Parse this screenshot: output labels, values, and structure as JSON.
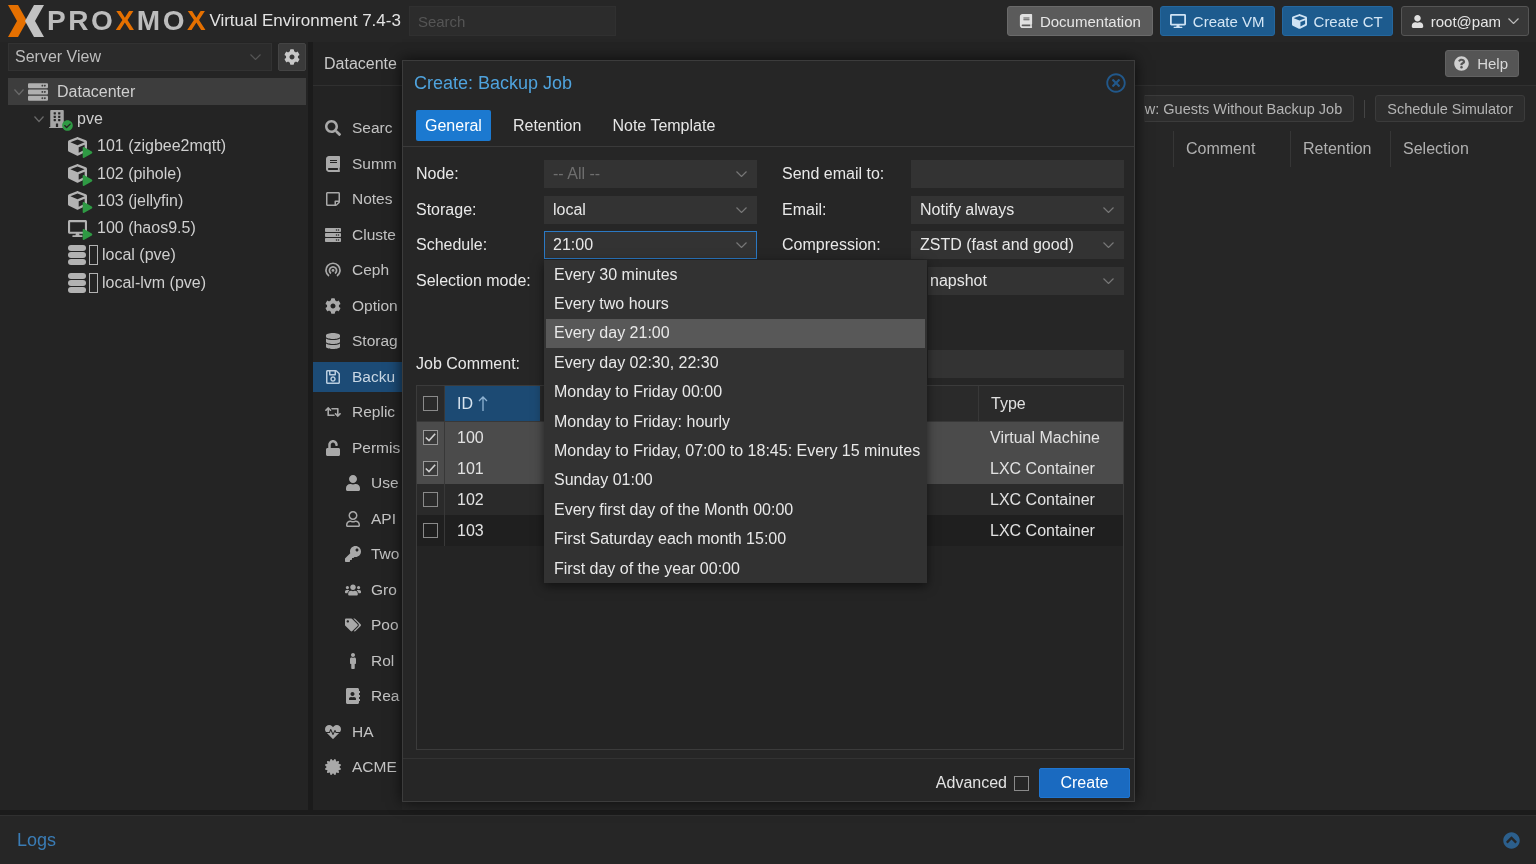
{
  "top_bar": {
    "logo": "PROXMOX",
    "product": "Virtual Environment 7.4-3",
    "search": {
      "placeholder": "Search"
    },
    "buttons": [
      {
        "label": "Documentation",
        "kind": "plain"
      },
      {
        "label": "Create VM",
        "kind": "primary"
      },
      {
        "label": "Create CT",
        "kind": "primary"
      },
      {
        "label": "root@pam",
        "kind": "menu"
      }
    ]
  },
  "sidebar": {
    "view_select": {
      "value": "Server View"
    },
    "tree": [
      {
        "label": "Datacenter",
        "kind": "datacenter",
        "selected": true,
        "expanded": true,
        "children": [
          {
            "label": "pve",
            "kind": "node",
            "selected": false,
            "expanded": true,
            "online": true,
            "children": [
              {
                "label": "101 (zigbee2mqtt)",
                "kind": "container",
                "selected": false,
                "running": true
              },
              {
                "label": "102 (pihole)",
                "kind": "container",
                "selected": false,
                "running": true
              },
              {
                "label": "103 (jellyfin)",
                "kind": "container",
                "selected": false,
                "running": true
              },
              {
                "label": "100 (haos9.5)",
                "kind": "vm",
                "selected": false,
                "running": true
              },
              {
                "label": "local (pve)",
                "kind": "storage",
                "selected": false,
                "running": false
              },
              {
                "label": "local-lvm (pve)",
                "kind": "storage",
                "selected": false,
                "running": false
              }
            ]
          }
        ]
      }
    ]
  },
  "main": {
    "breadcrumb": "Datacente",
    "help_button": "Help",
    "nav": [
      {
        "label": "Searc",
        "selected": false
      },
      {
        "label": "Summ",
        "selected": false
      },
      {
        "label": "Notes",
        "selected": false
      },
      {
        "label": "Cluste",
        "selected": false
      },
      {
        "label": "Ceph",
        "selected": false
      },
      {
        "label": "Option",
        "selected": false
      },
      {
        "label": "Storag",
        "selected": false
      },
      {
        "label": "Backu",
        "selected": true
      },
      {
        "label": "Replic",
        "selected": false
      },
      {
        "label": "Permis",
        "selected": false,
        "children": [
          {
            "label": "Use",
            "selected": false
          },
          {
            "label": "API",
            "selected": false
          },
          {
            "label": "Two",
            "selected": false
          },
          {
            "label": "Gro",
            "selected": false
          },
          {
            "label": "Poo",
            "selected": false
          },
          {
            "label": "Rol",
            "selected": false
          },
          {
            "label": "Rea",
            "selected": false
          }
        ]
      },
      {
        "label": "HA",
        "selected": false
      },
      {
        "label": "ACME",
        "selected": false
      }
    ],
    "toolbar": [
      "w: Guests Without Backup Job",
      "Schedule Simulator"
    ],
    "columns": [
      "Comment",
      "Retention",
      "Selection"
    ]
  },
  "dialog": {
    "title": "Create: Backup Job",
    "tabs": [
      {
        "label": "General",
        "selected": true
      },
      {
        "label": "Retention",
        "selected": false
      },
      {
        "label": "Note Template",
        "selected": false
      }
    ],
    "form_left": [
      {
        "label": "Node:",
        "kind": "combo",
        "placeholder": "-- All --",
        "focused": false
      },
      {
        "label": "Storage:",
        "kind": "combo",
        "value": "local",
        "focused": false
      },
      {
        "label": "Schedule:",
        "kind": "combo",
        "value": "21:00",
        "focused": true
      },
      {
        "label": "Selection mode:"
      }
    ],
    "form_right": [
      {
        "label": "Send email to:",
        "kind": "text",
        "focused": false
      },
      {
        "label": "Email:",
        "kind": "combo",
        "value": "Notify always",
        "focused": false
      },
      {
        "label": "Compression:",
        "kind": "combo",
        "value": "ZSTD (fast and good)",
        "focused": false
      },
      {
        "kind": "combo",
        "value": "napshot",
        "focused": false
      }
    ],
    "job_comment": {
      "label": "Job Comment:"
    },
    "guest_table": {
      "all_checked": false,
      "columns": [
        {
          "label": "ID",
          "sorted": true
        },
        {
          "label": "Type",
          "sorted": false
        }
      ],
      "rows": [
        {
          "id": "100",
          "type": "Virtual Machine",
          "checked": true,
          "selected": true
        },
        {
          "id": "101",
          "type": "LXC Container",
          "checked": true,
          "selected": true
        },
        {
          "id": "102",
          "type": "LXC Container",
          "checked": false,
          "selected": false
        },
        {
          "id": "103",
          "type": "LXC Container",
          "checked": false,
          "selected": false
        }
      ]
    },
    "schedule_options": [
      {
        "label": "Every 30 minutes",
        "selected": false
      },
      {
        "label": "Every two hours",
        "selected": false
      },
      {
        "label": "Every day 21:00",
        "selected": true
      },
      {
        "label": "Every day 02:30, 22:30",
        "selected": false
      },
      {
        "label": "Monday to Friday 00:00",
        "selected": false
      },
      {
        "label": "Monday to Friday: hourly",
        "selected": false
      },
      {
        "label": "Monday to Friday, 07:00 to 18:45: Every 15 minutes",
        "selected": false
      },
      {
        "label": "Sunday 01:00",
        "selected": false
      },
      {
        "label": "Every first day of the Month 00:00",
        "selected": false
      },
      {
        "label": "First Saturday each month 15:00",
        "selected": false
      },
      {
        "label": "First day of the year 00:00",
        "selected": false
      }
    ],
    "advanced": {
      "label": "Advanced",
      "checked": false
    },
    "submit_button": "Create"
  },
  "logs_panel": {
    "title": "Logs"
  }
}
